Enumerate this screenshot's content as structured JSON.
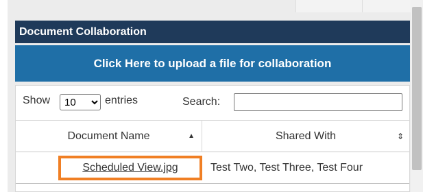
{
  "section": {
    "title": "Document Collaboration"
  },
  "upload": {
    "label": "Click Here to upload a file for collaboration"
  },
  "controls": {
    "show_label": "Show",
    "page_size": "10",
    "page_size_options": [
      "10"
    ],
    "entries_label": "entries",
    "search_label": "Search:",
    "search_value": ""
  },
  "table": {
    "columns": [
      {
        "label": "Document Name",
        "sort": "ascending",
        "sort_icon": "sort-asc-icon"
      },
      {
        "label": "Shared With",
        "sort": "none",
        "sort_icon": "sort-both-icon"
      }
    ],
    "rows": [
      {
        "name": "Scheduled View.jpg",
        "shared_with": "Test Two, Test Three, Test Four",
        "highlighted": true
      }
    ]
  },
  "colors": {
    "title_bar": "#1f3a5a",
    "upload_button": "#1f6fa7",
    "highlight": "#f07f24"
  }
}
